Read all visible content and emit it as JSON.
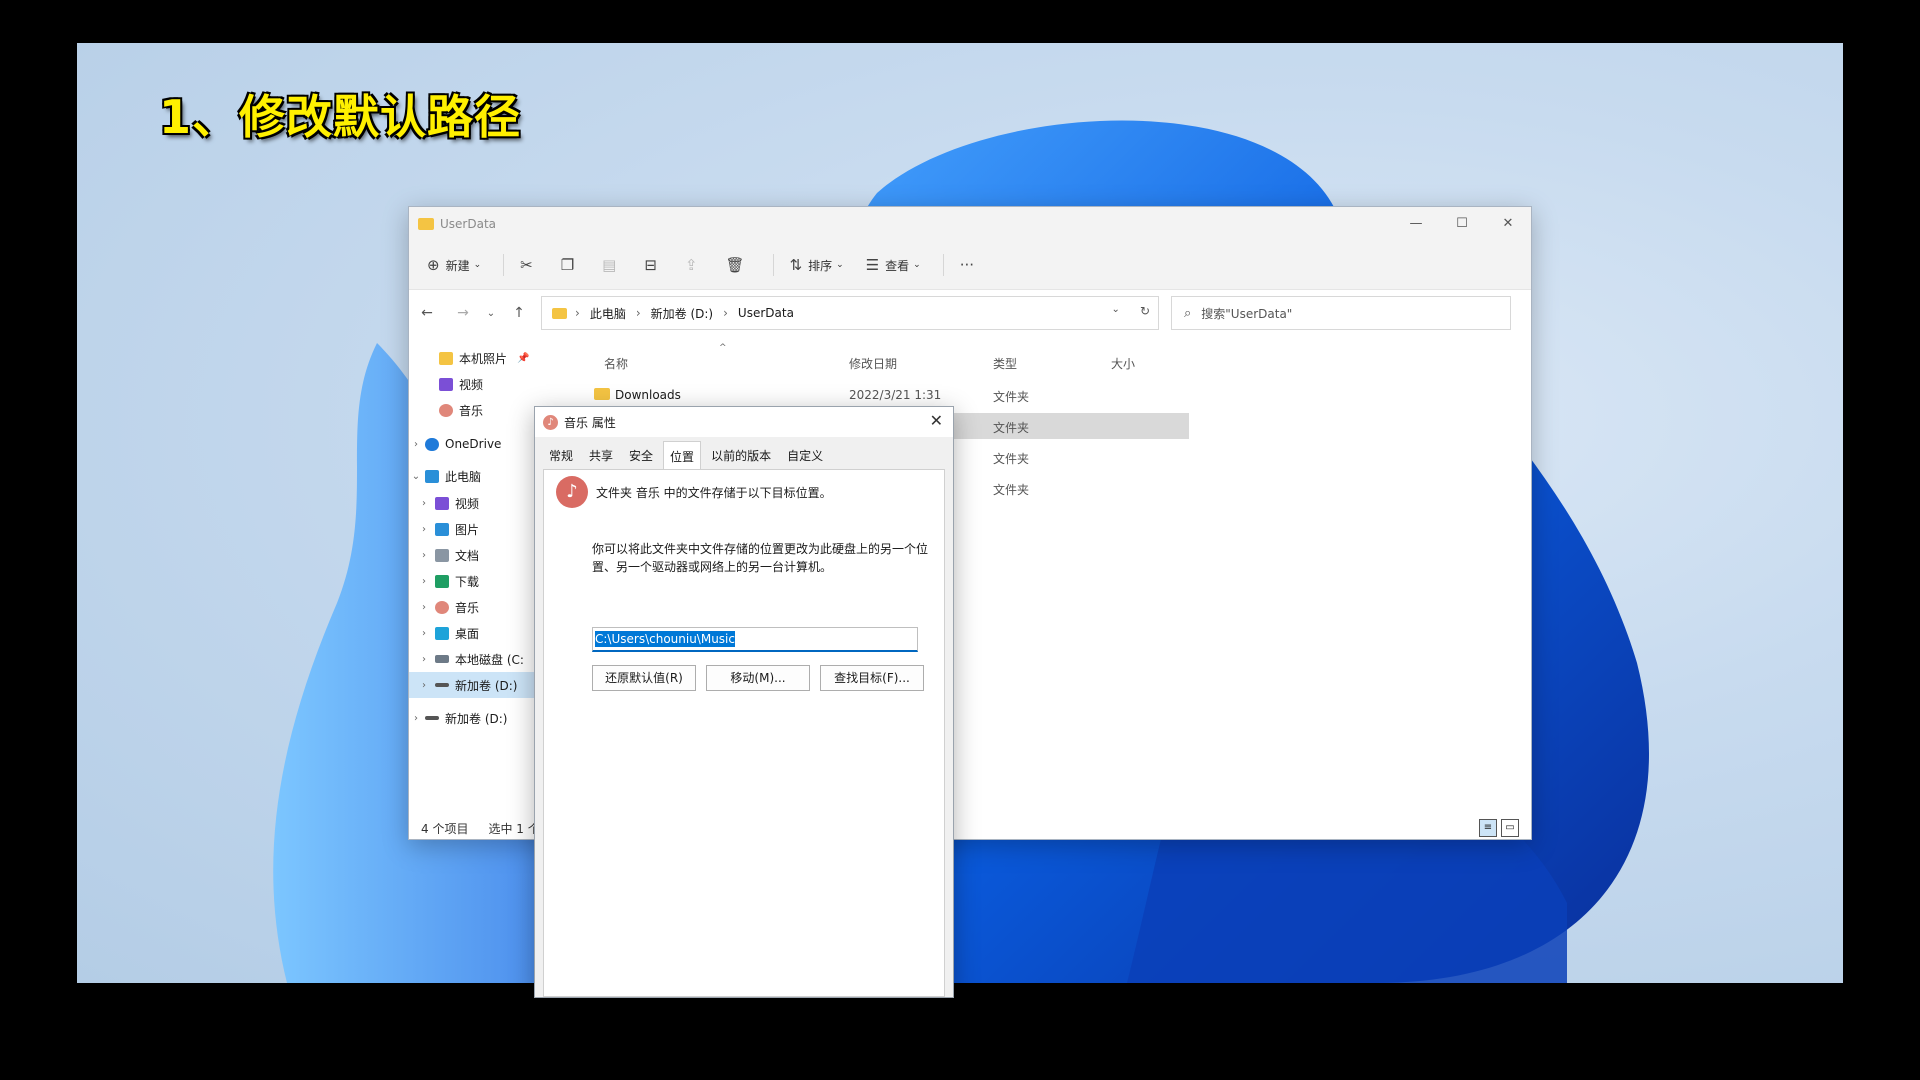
{
  "caption": "1、修改默认路径",
  "explorer": {
    "title": "UserData",
    "window_controls": [
      "—",
      "☐",
      "✕"
    ],
    "toolbar": {
      "new": "新建",
      "sort": "排序",
      "view": "查看",
      "more": "···"
    },
    "address": {
      "crumbs": [
        "此电脑",
        "新加卷 (D:)",
        "UserData"
      ]
    },
    "search_placeholder": "搜索\"UserData\"",
    "sidebar": [
      {
        "label": "本机照片",
        "color": "#f4c443"
      },
      {
        "label": "视频",
        "color": "#7b4fd6"
      },
      {
        "label": "音乐",
        "color": "#e0877a"
      },
      {
        "label": "OneDrive",
        "color": "#1f7ad9"
      },
      {
        "label": "此电脑",
        "color": "#2a8fd8"
      },
      {
        "label": "视频",
        "color": "#7b4fd6"
      },
      {
        "label": "图片",
        "color": "#2a8fd8"
      },
      {
        "label": "文档",
        "color": "#8a96a3"
      },
      {
        "label": "下载",
        "color": "#1f9e63"
      },
      {
        "label": "音乐",
        "color": "#e0877a"
      },
      {
        "label": "桌面",
        "color": "#1ea3d9"
      },
      {
        "label": "本地磁盘 (C:",
        "color": "#6d7a87"
      },
      {
        "label": "新加卷 (D:)",
        "color": "#555555"
      },
      {
        "label": "新加卷 (D:)",
        "color": "#555555"
      }
    ],
    "columns": [
      "名称",
      "修改日期",
      "类型",
      "大小"
    ],
    "files": [
      {
        "name": "Downloads",
        "date": "2022/3/21 1:31",
        "type": "文件夹"
      },
      {
        "name": "",
        "date": "",
        "type": "文件夹"
      },
      {
        "name": "",
        "date": "",
        "type": "文件夹"
      },
      {
        "name": "",
        "date": "",
        "type": "文件夹"
      }
    ],
    "status": {
      "count": "4 个项目",
      "selected": "选中 1 个"
    }
  },
  "dialog": {
    "title": "音乐 属性",
    "tabs": [
      "常规",
      "共享",
      "安全",
      "位置",
      "以前的版本",
      "自定义"
    ],
    "active_tab": "位置",
    "message": "文件夹 音乐 中的文件存储于以下目标位置。",
    "description": "你可以将此文件夹中文件存储的位置更改为此硬盘上的另一个位置、另一个驱动器或网络上的另一台计算机。",
    "path_value": "C:\\Users\\chouniu\\Music",
    "buttons": {
      "restore": "还原默认值(R)",
      "move": "移动(M)...",
      "find": "查找目标(F)..."
    }
  }
}
